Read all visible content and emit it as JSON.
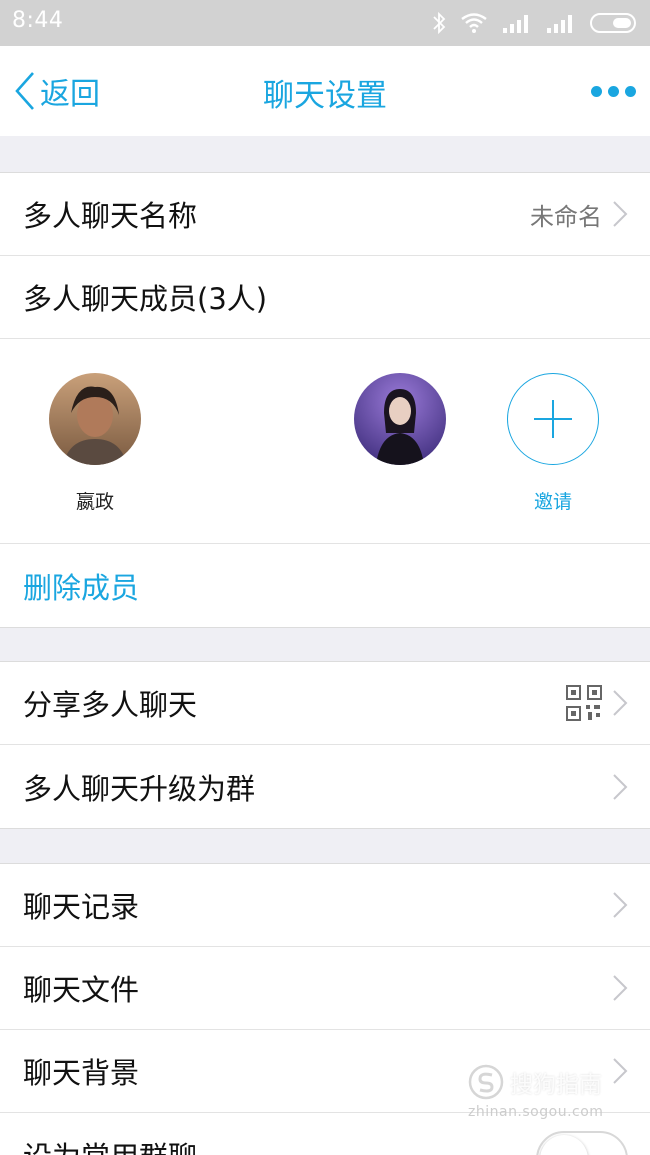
{
  "status_bar": {
    "time": "8:44"
  },
  "nav": {
    "back_label": "返回",
    "title": "聊天设置"
  },
  "chat_name": {
    "label": "多人聊天名称",
    "value": "未命名"
  },
  "members": {
    "header": "多人聊天成员(3人)",
    "list": [
      {
        "name": "嬴政"
      },
      {
        "name": ""
      }
    ],
    "invite_label": "邀请",
    "delete_label": "删除成员"
  },
  "share": {
    "share_label": "分享多人聊天",
    "upgrade_label": "多人聊天升级为群"
  },
  "chat_section": {
    "items": [
      {
        "label": "聊天记录"
      },
      {
        "label": "聊天文件"
      },
      {
        "label": "聊天背景"
      },
      {
        "label": "设为常用群聊"
      }
    ]
  },
  "watermark": {
    "brand": "搜狗指南",
    "url": "zhinan.sogou.com"
  },
  "colors": {
    "accent": "#1aa6e0",
    "status_bar": "#d2d2d2",
    "background": "#efeff4"
  }
}
